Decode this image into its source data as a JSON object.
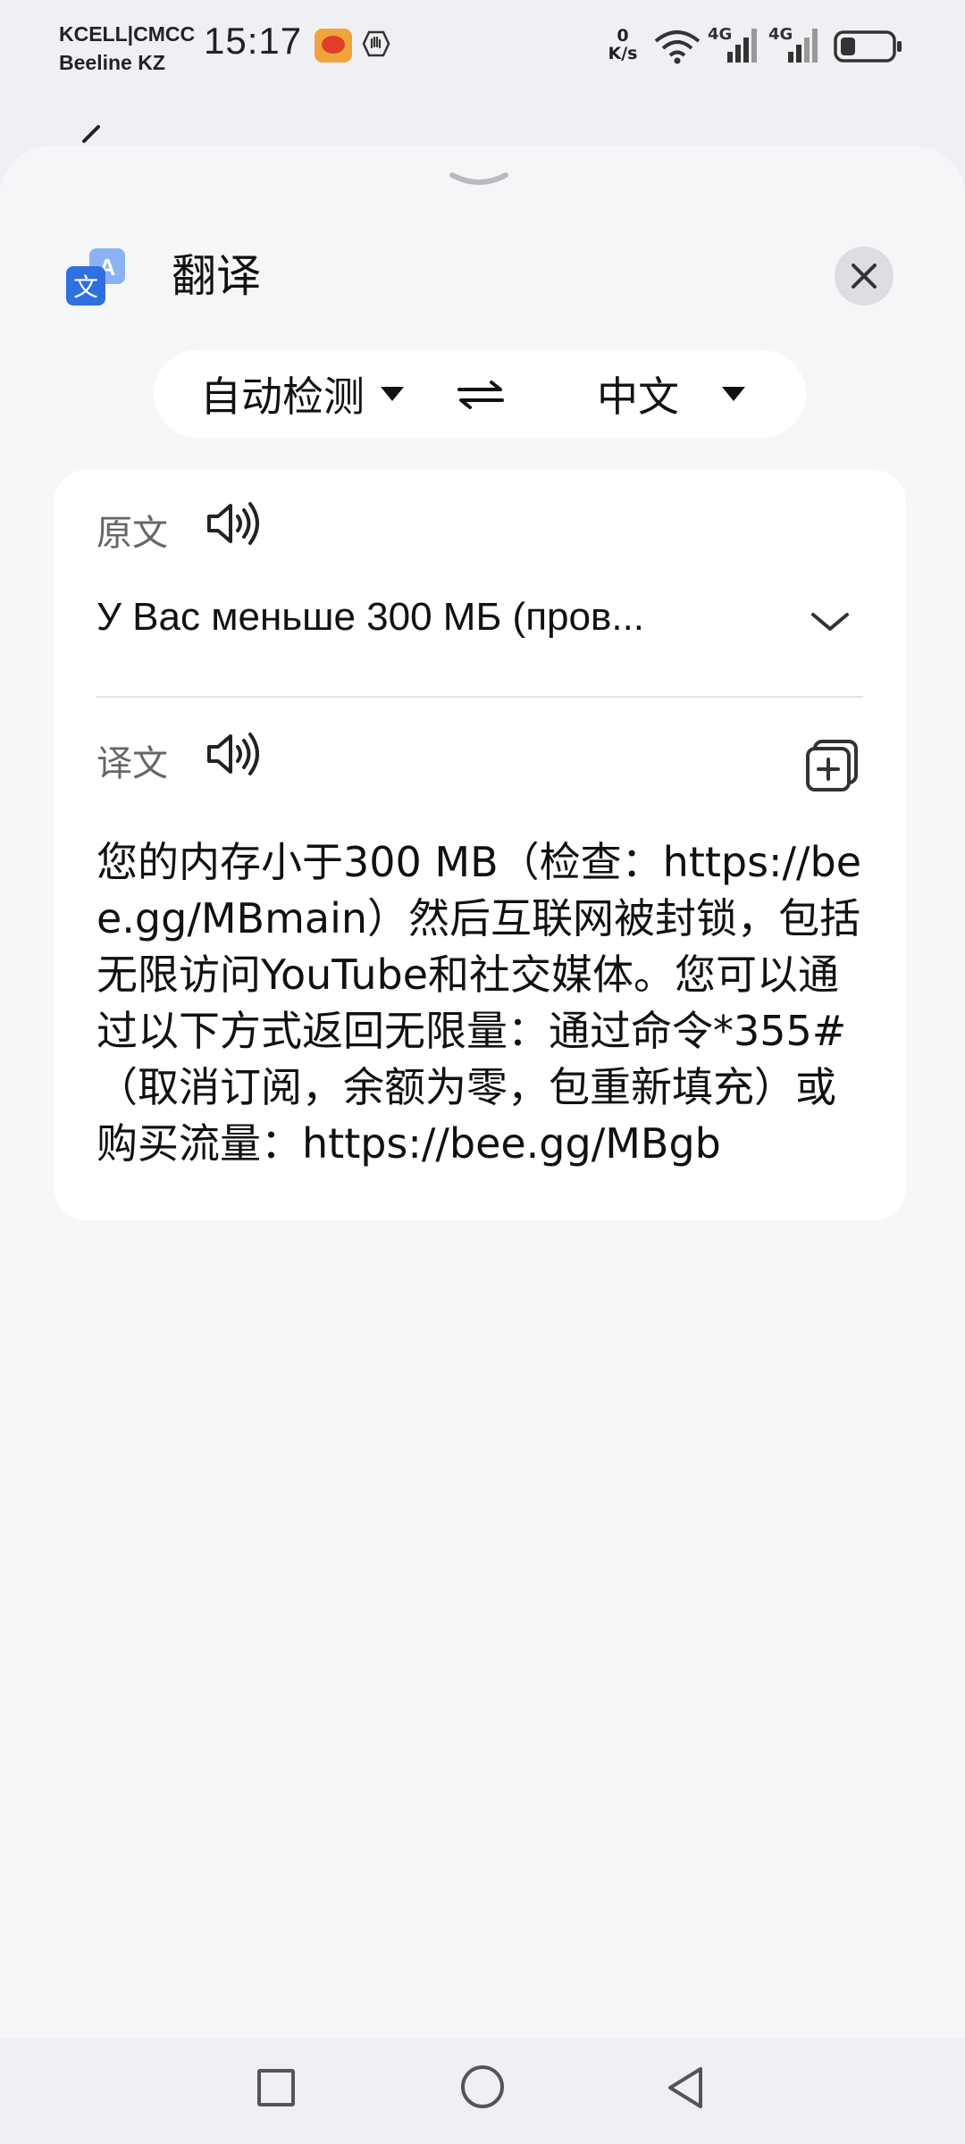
{
  "status_bar": {
    "carrier_line1": "KCELL|CMCC",
    "carrier_line2": "Beeline KZ",
    "time": "15:17",
    "net_speed_value": "0",
    "net_speed_unit": "K/s",
    "network_1": "4G",
    "network_2": "4G",
    "battery_level": 0.3
  },
  "sheet": {
    "title": "翻译",
    "source_language": "自动检测",
    "target_language": "中文",
    "original_label": "原文",
    "source_text": "У Вас меньше 300 МБ (пров...",
    "translation_label": "译文",
    "translated_text": "您的内存小于300 MB（检查：https://bee.gg/MBmain）然后互联网被封锁，包括无限访问YouTube和社交媒体。您可以通过以下方式返回无限量：通过命令*355#（取消订阅，余额为零，包重新填充）或购买流量：https://bee.gg/MBgb"
  },
  "icons": {
    "app": "translate-icon",
    "close": "close-icon",
    "swap": "swap-icon",
    "speaker": "speaker-icon",
    "expand": "chevron-down-icon",
    "copy": "copy-add-icon"
  },
  "colors": {
    "accent": "#2f6fe0",
    "background": "#f5f6f8",
    "card": "#ffffff"
  }
}
